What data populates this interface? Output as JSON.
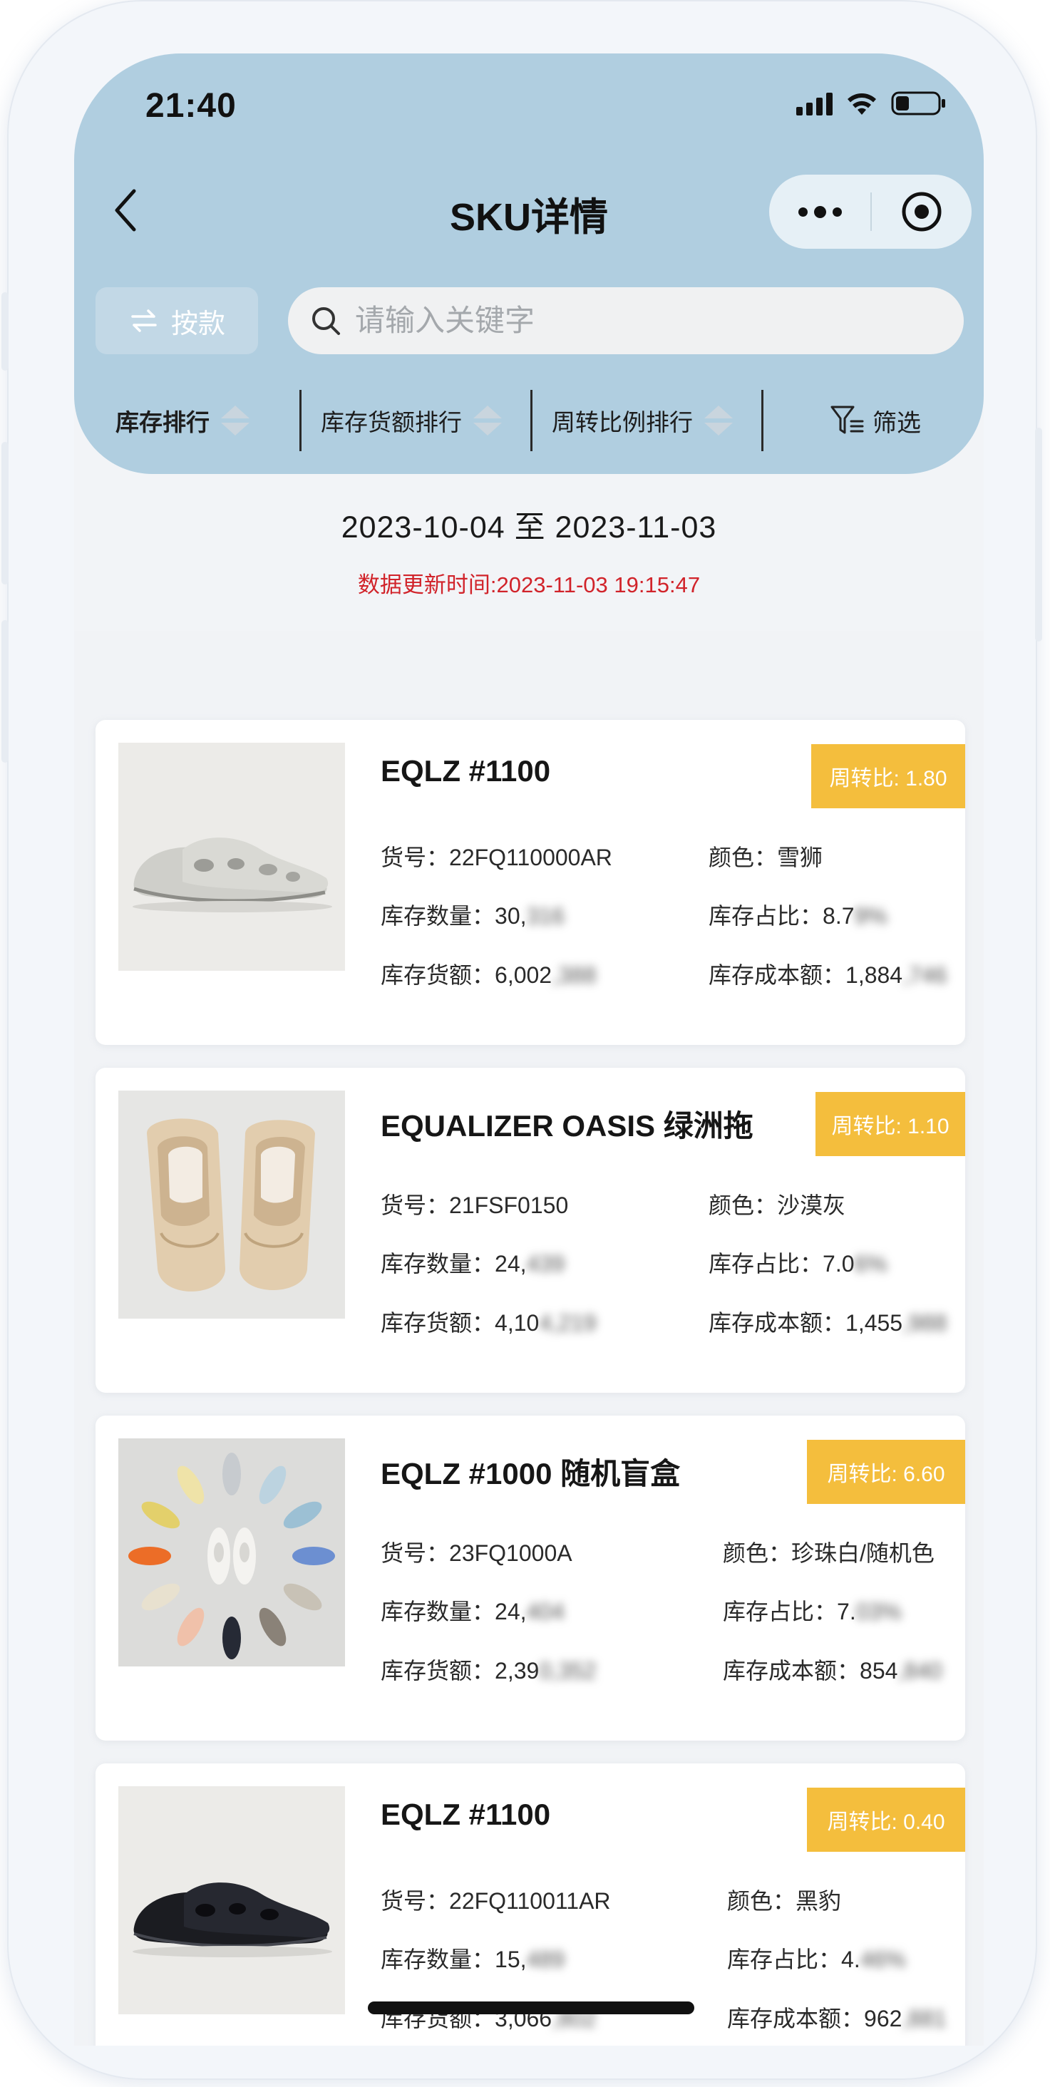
{
  "status_bar": {
    "time": "21:40"
  },
  "nav": {
    "title": "SKU详情"
  },
  "controls": {
    "style_toggle_label": "按款",
    "search_placeholder": "请输入关键字"
  },
  "sort_bar": {
    "items": [
      {
        "label": "库存排行"
      },
      {
        "label": "库存货额排行"
      },
      {
        "label": "周转比例排行"
      }
    ],
    "filter_label": "筛选"
  },
  "date_range": "2023-10-04 至 2023-11-03",
  "update_time": "数据更新时间:2023-11-03 19:15:47",
  "products": [
    {
      "name": "EQLZ #1100",
      "turnover": "周转比: 1.80",
      "sku_label": "货号：",
      "sku": "22FQ110000AR",
      "color_label": "颜色：",
      "color": "雪狮",
      "qty_label": "库存数量：",
      "qty_visible": "30,",
      "qty_hidden": "316",
      "ratio_label": "库存占比：",
      "ratio_visible": "8.7",
      "ratio_hidden": "9%",
      "amount_label": "库存货额：",
      "amount_visible": "6,002",
      "amount_hidden": ",388",
      "cost_label": "库存成本额：",
      "cost_visible": "1,884",
      "cost_hidden": ",746",
      "image": "grey-slide"
    },
    {
      "name": "EQUALIZER OASIS 绿洲拖",
      "turnover": "周转比: 1.10",
      "sku_label": "货号：",
      "sku": "21FSF0150",
      "color_label": "颜色：",
      "color": "沙漠灰",
      "qty_label": "库存数量：",
      "qty_visible": "24,",
      "qty_hidden": "439",
      "ratio_label": "库存占比：",
      "ratio_visible": "7.0",
      "ratio_hidden": "6%",
      "amount_label": "库存货额：",
      "amount_visible": "4,10",
      "amount_hidden": "4,219",
      "cost_label": "库存成本额：",
      "cost_visible": "1,455",
      "cost_hidden": ",988",
      "image": "sand-slide"
    },
    {
      "name": "EQLZ #1000 随机盲盒",
      "turnover": "周转比: 6.60",
      "sku_label": "货号：",
      "sku": "23FQ1000A",
      "color_label": "颜色：",
      "color": "珍珠白/随机色",
      "qty_label": "库存数量：",
      "qty_visible": "24,",
      "qty_hidden": "404",
      "ratio_label": "库存占比：",
      "ratio_visible": "7.",
      "ratio_hidden": "03%",
      "amount_label": "库存货额：",
      "amount_visible": "2,39",
      "amount_hidden": "0,352",
      "cost_label": "库存成本额：",
      "cost_visible": "854",
      "cost_hidden": ",840",
      "image": "blind-box"
    },
    {
      "name": "EQLZ #1100",
      "turnover": "周转比: 0.40",
      "sku_label": "货号：",
      "sku": "22FQ110011AR",
      "color_label": "颜色：",
      "color": "黑豹",
      "qty_label": "库存数量：",
      "qty_visible": "15,",
      "qty_hidden": "489",
      "ratio_label": "库存占比：",
      "ratio_visible": "4.",
      "ratio_hidden": "46%",
      "amount_label": "库存货额：",
      "amount_visible": "3,066",
      "amount_hidden": ",802",
      "cost_label": "库存成本额：",
      "cost_visible": "962",
      "cost_hidden": ",881",
      "image": "black-slide"
    }
  ],
  "colors": {
    "header_bg": "#b0cee0",
    "badge_bg": "#f4be3d",
    "update_time_red": "#d1232a"
  }
}
